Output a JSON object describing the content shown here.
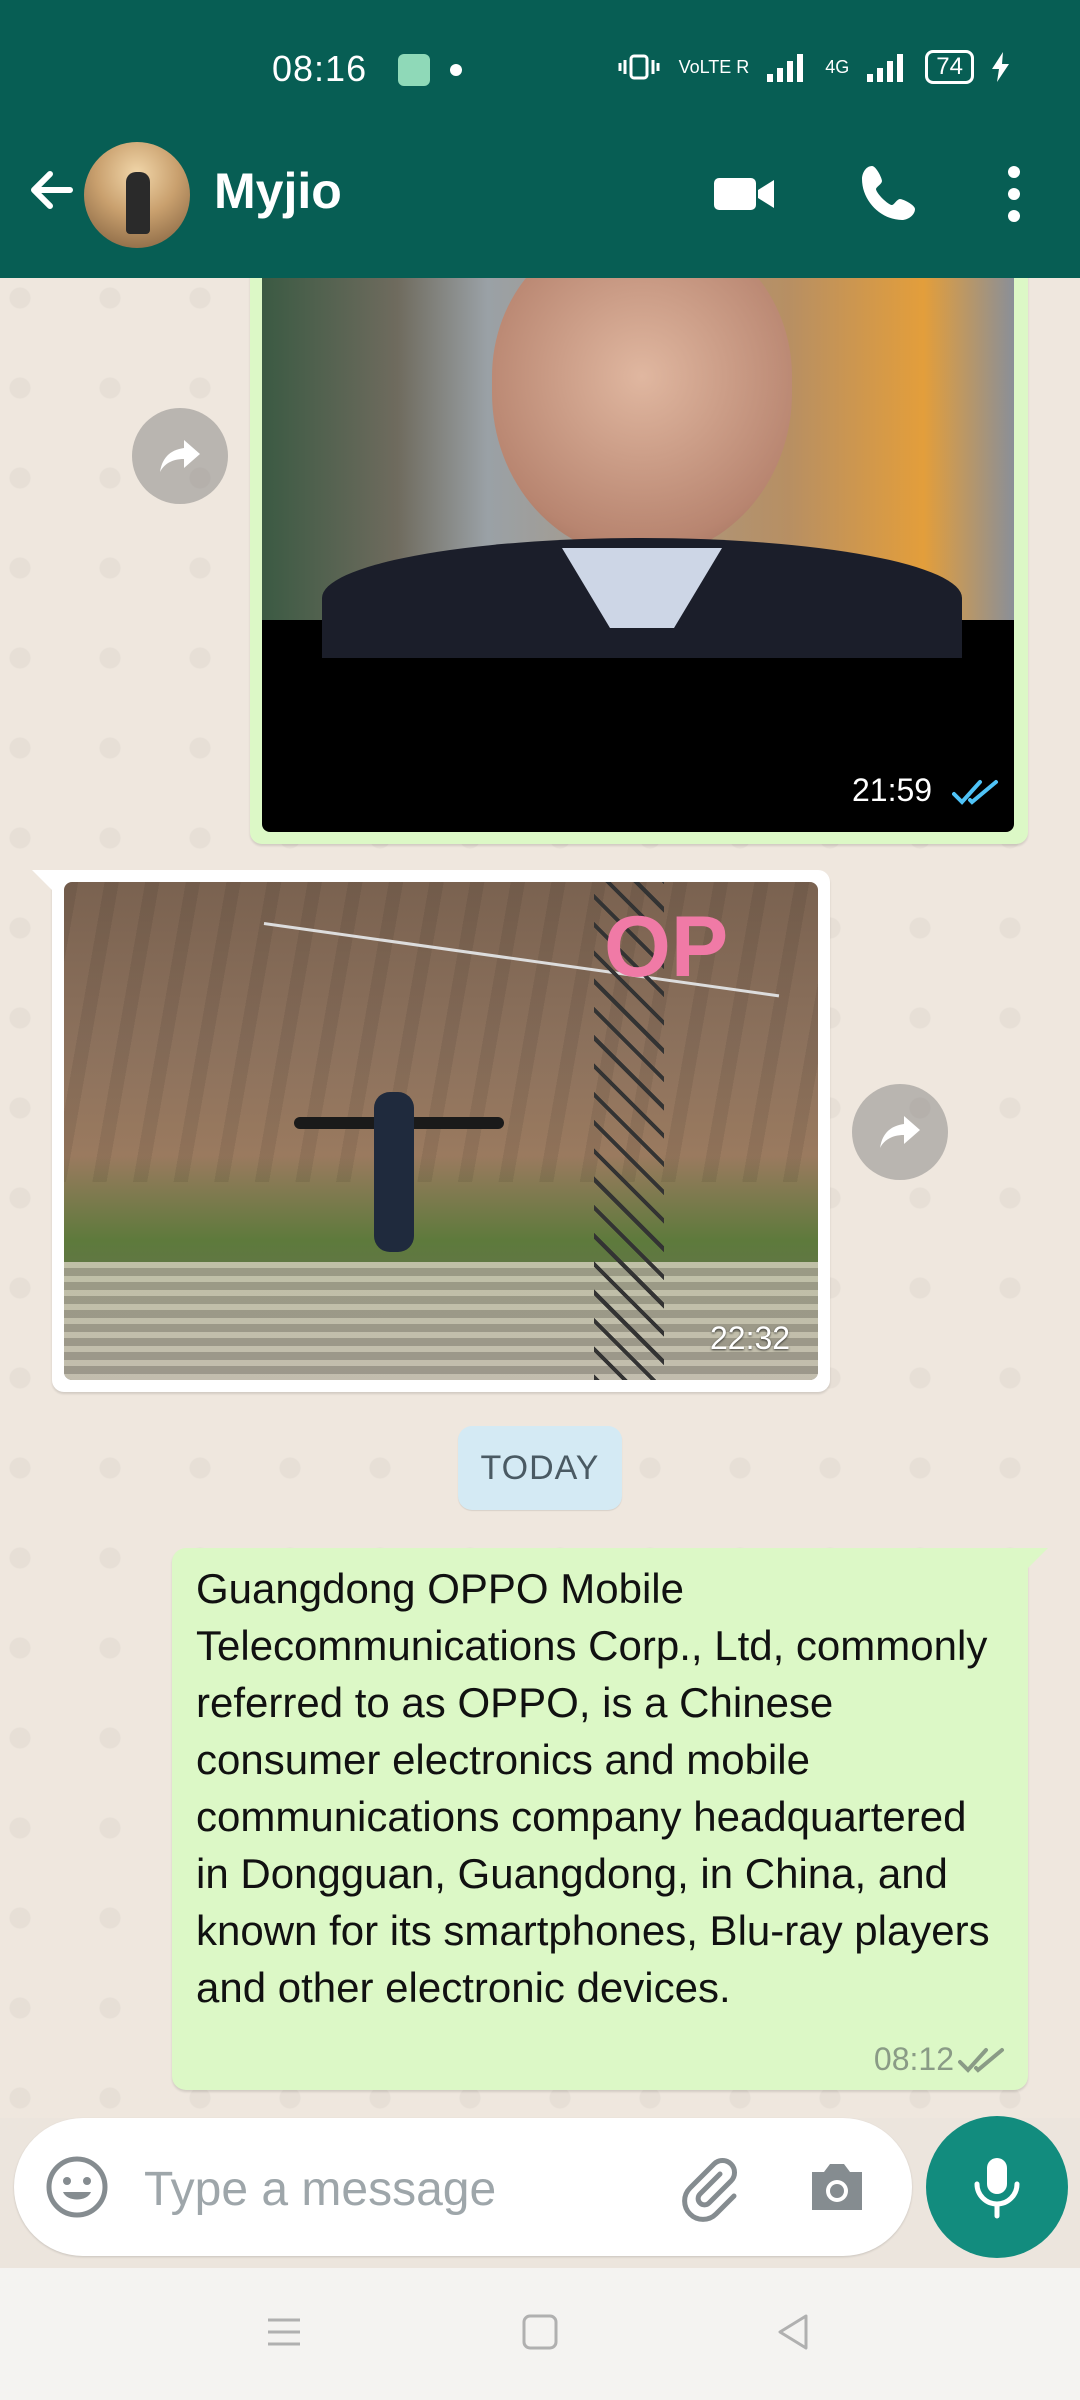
{
  "status_bar": {
    "time": "08:16",
    "network_1": "VoLTE R",
    "network_2": "4G",
    "battery": "74"
  },
  "header": {
    "contact_name": "Myjio"
  },
  "messages": [
    {
      "type": "image",
      "direction": "outgoing",
      "time": "21:59",
      "ticks": "read"
    },
    {
      "type": "image",
      "direction": "incoming",
      "time": "22:32",
      "photo_text": "OP"
    },
    {
      "type": "date_divider",
      "label": "TODAY"
    },
    {
      "type": "text",
      "direction": "outgoing",
      "text": "Guangdong OPPO Mobile Telecommunications Corp., Ltd, commonly referred to as OPPO, is a Chinese consumer electronics and mobile communications company headquartered in Dongguan, Guangdong, in China, and known for its smartphones, Blu-ray players and other electronic devices.",
      "time": "08:12",
      "ticks": "delivered"
    }
  ],
  "composer": {
    "placeholder": "Type a message"
  },
  "colors": {
    "header_bg": "#075e54",
    "outgoing_bubble": "#dcf8c6",
    "mic_button": "#128c7e",
    "read_ticks": "#4fc3f7"
  }
}
